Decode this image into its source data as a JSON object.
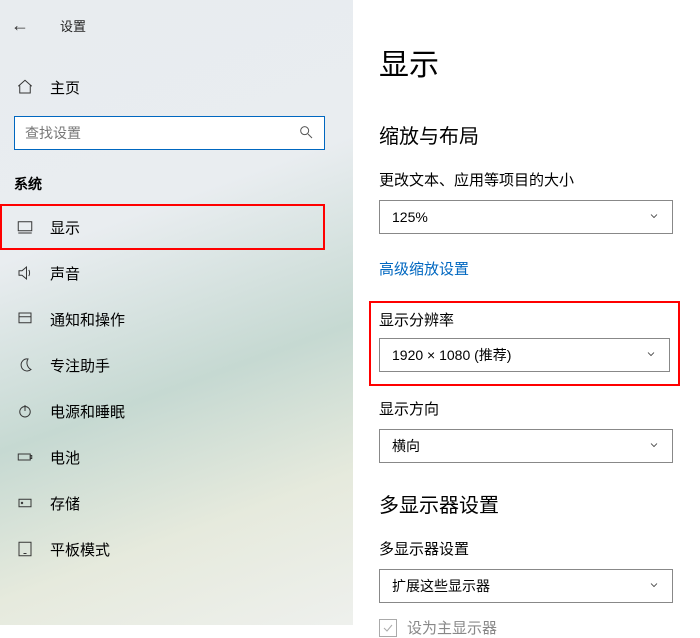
{
  "header": {
    "settings_label": "设置"
  },
  "sidebar": {
    "home_label": "主页",
    "search_placeholder": "查找设置",
    "section_label": "系统",
    "items": [
      {
        "label": "显示"
      },
      {
        "label": "声音"
      },
      {
        "label": "通知和操作"
      },
      {
        "label": "专注助手"
      },
      {
        "label": "电源和睡眠"
      },
      {
        "label": "电池"
      },
      {
        "label": "存储"
      },
      {
        "label": "平板模式"
      }
    ]
  },
  "page": {
    "title": "显示",
    "scale_section": "缩放与布局",
    "scale_field_label": "更改文本、应用等项目的大小",
    "scale_value": "125%",
    "advanced_scale_link": "高级缩放设置",
    "resolution_label": "显示分辨率",
    "resolution_value": "1920 × 1080 (推荐)",
    "orientation_label": "显示方向",
    "orientation_value": "横向",
    "multi_section": "多显示器设置",
    "multi_field_label": "多显示器设置",
    "multi_value": "扩展这些显示器",
    "primary_checkbox_label": "设为主显示器"
  }
}
